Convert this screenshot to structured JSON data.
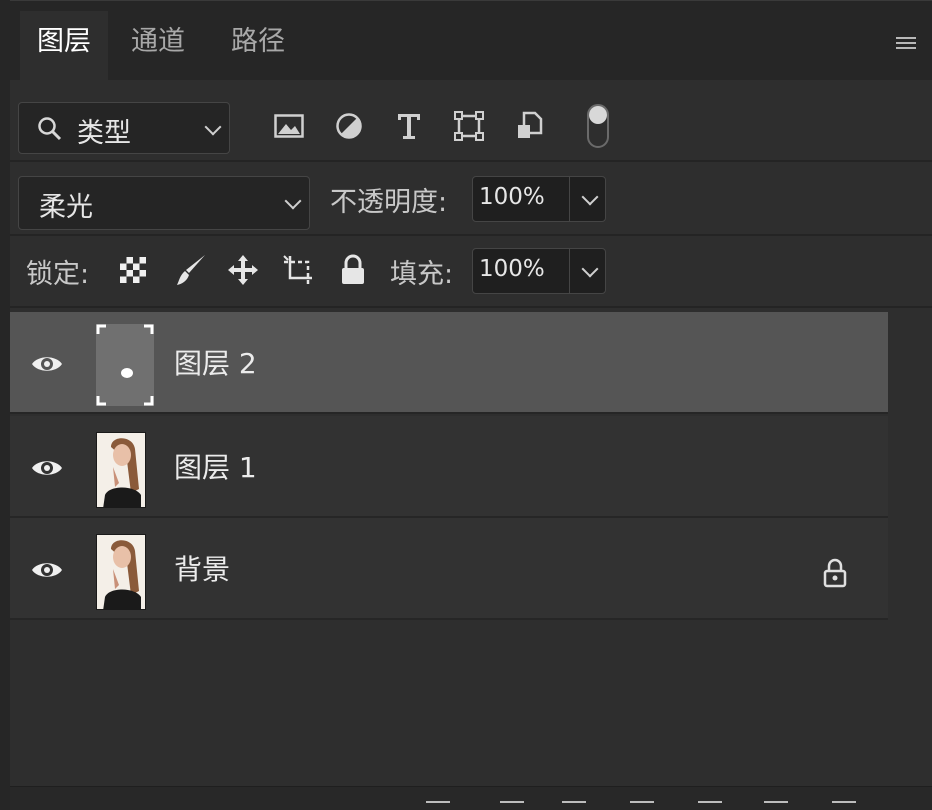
{
  "tabs": [
    {
      "label": "图层",
      "active": true
    },
    {
      "label": "通道",
      "active": false
    },
    {
      "label": "路径",
      "active": false
    }
  ],
  "filter": {
    "kind_label": "类型",
    "icons": [
      "image-filter-icon",
      "adjustment-filter-icon",
      "type-filter-icon",
      "shape-filter-icon",
      "smart-object-filter-icon",
      "filter-toggle-icon"
    ]
  },
  "blend": {
    "mode": "柔光",
    "opacity_label": "不透明度:",
    "opacity_value": "100%"
  },
  "lock": {
    "label": "锁定:",
    "icons": [
      "lock-transparent-pixels-icon",
      "lock-image-pixels-icon",
      "lock-position-icon",
      "lock-artboard-icon",
      "lock-all-icon"
    ],
    "fill_label": "填充:",
    "fill_value": "100%"
  },
  "layers": [
    {
      "name": "图层 2",
      "visible": true,
      "selected": true,
      "locked": false
    },
    {
      "name": "图层 1",
      "visible": true,
      "selected": false,
      "locked": false
    },
    {
      "name": "背景",
      "visible": true,
      "selected": false,
      "locked": true
    }
  ],
  "colors": {
    "panel_bg": "#2e2e2e",
    "selected_row": "#555555",
    "text": "#ececec"
  }
}
